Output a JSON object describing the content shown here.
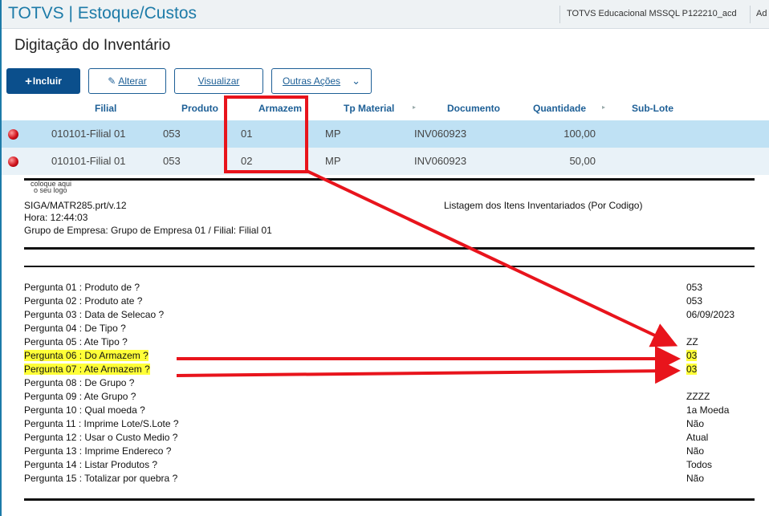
{
  "app": {
    "title": "TOTVS | Estoque/Custos",
    "env": "TOTVS Educacional MSSQL P122210_acd",
    "user_abbrev": "Ad"
  },
  "page": {
    "title": "Digitação do Inventário"
  },
  "toolbar": {
    "include": "Incluir",
    "edit": "Alterar",
    "view": "Visualizar",
    "more": "Outras Ações"
  },
  "grid": {
    "headers": [
      "Filial",
      "Produto",
      "Armazem",
      "Tp Material",
      "Documento",
      "Quantidade",
      "Sub-Lote"
    ],
    "rows": [
      {
        "filial": "010101-Filial 01",
        "produto": "053",
        "armazem": "01",
        "tp": "MP",
        "documento": "INV060923",
        "quantidade": "100,00"
      },
      {
        "filial": "010101-Filial 01",
        "produto": "053",
        "armazem": "02",
        "tp": "MP",
        "documento": "INV060923",
        "quantidade": "50,00"
      }
    ]
  },
  "report": {
    "logo_line1": "coloque aqui",
    "logo_line2": "o seu logo",
    "program": "SIGA/MATR285.prt/v.12",
    "title": "Listagem dos Itens Inventariados (Por Codigo)",
    "hora": "Hora: 12:44:03",
    "grupo": "Grupo de Empresa: Grupo de Empresa 01 / Filial: Filial 01",
    "params": [
      {
        "q": "Pergunta 01 : Produto de ?",
        "v": "053"
      },
      {
        "q": "Pergunta 02 : Produto ate ?",
        "v": "053"
      },
      {
        "q": "Pergunta 03 : Data de Selecao ?",
        "v": "06/09/2023"
      },
      {
        "q": "Pergunta 04 : De  Tipo ?",
        "v": ""
      },
      {
        "q": "Pergunta 05 : Ate Tipo ?",
        "v": "ZZ"
      },
      {
        "q": "Pergunta 06 : Do Armazem ?",
        "v": "03"
      },
      {
        "q": "Pergunta 07 : Ate Armazem ?",
        "v": "03"
      },
      {
        "q": "Pergunta 08 : De  Grupo ?",
        "v": ""
      },
      {
        "q": "Pergunta 09 : Ate Grupo ?",
        "v": "ZZZZ"
      },
      {
        "q": "Pergunta 10 : Qual moeda ?",
        "v": "1a Moeda"
      },
      {
        "q": "Pergunta 11 : Imprime Lote/S.Lote ?",
        "v": "Não"
      },
      {
        "q": "Pergunta 12 : Usar o Custo Medio ?",
        "v": "Atual"
      },
      {
        "q": "Pergunta 13 : Imprime Endereco ?",
        "v": "Não"
      },
      {
        "q": "Pergunta 14 : Listar Produtos ?",
        "v": "Todos"
      },
      {
        "q": "Pergunta 15 : Totalizar por quebra ?",
        "v": "Não"
      }
    ]
  },
  "annotation_color": "#e8141c",
  "highlight_color": "#ffff38"
}
